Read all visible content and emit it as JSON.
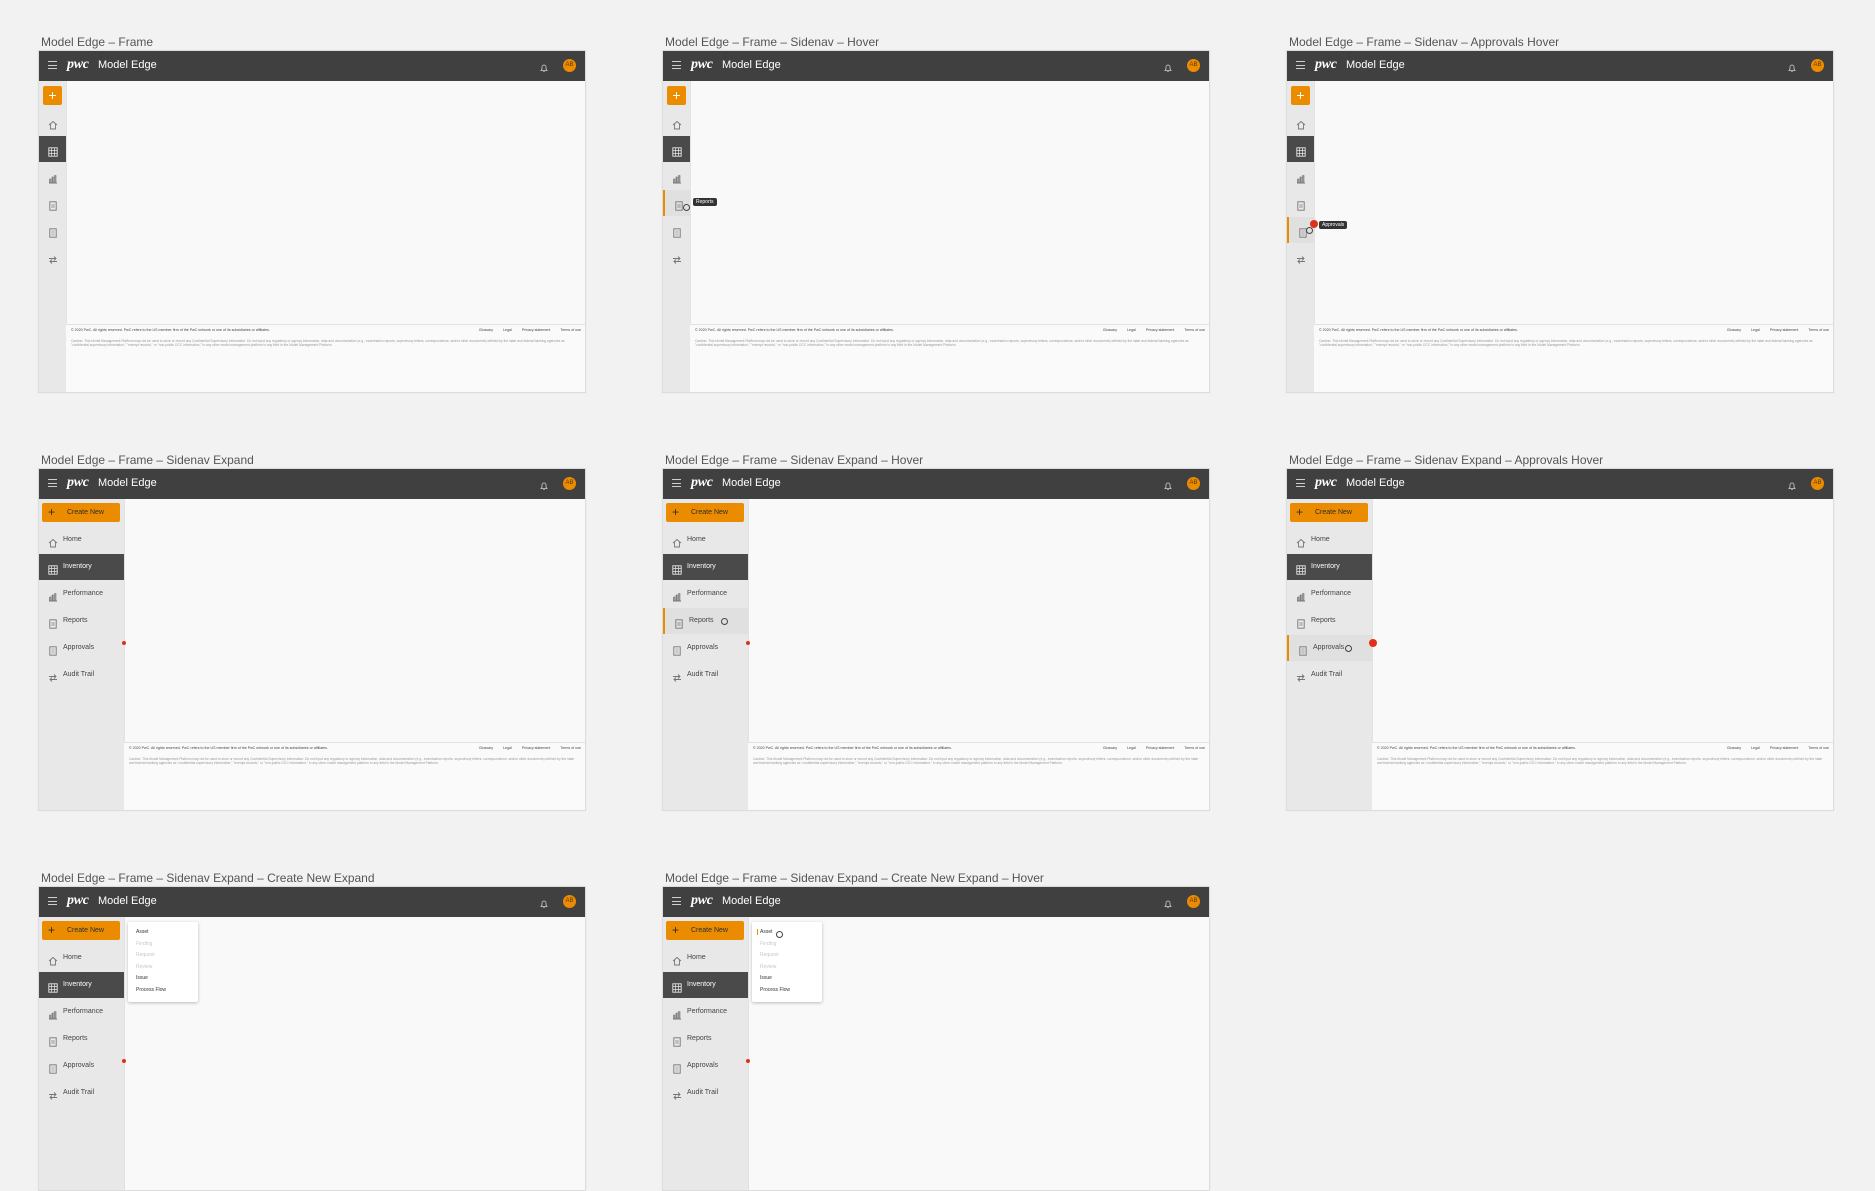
{
  "app": {
    "logo": "pwc",
    "name": "Model Edge",
    "avatar_initials": "AB"
  },
  "frames": [
    {
      "title": "Model Edge – Frame"
    },
    {
      "title": "Model Edge – Frame – Sidenav – Hover"
    },
    {
      "title": "Model Edge – Frame – Sidenav – Approvals Hover"
    },
    {
      "title": "Model Edge – Frame – Sidenav Expand"
    },
    {
      "title": "Model Edge – Frame – Sidenav Expand – Hover"
    },
    {
      "title": "Model Edge – Frame – Sidenav Expand – Approvals Hover"
    },
    {
      "title": "Model Edge – Frame – Sidenav Expand – Create New Expand"
    },
    {
      "title": "Model Edge – Frame – Sidenav Expand – Create New Expand – Hover"
    }
  ],
  "nav": {
    "create_new": "Create New",
    "items": [
      "Home",
      "Inventory",
      "Performance",
      "Reports",
      "Approvals",
      "Audit Trail"
    ]
  },
  "tooltips": {
    "reports": "Reports",
    "approvals": "Approvals"
  },
  "create_menu": [
    "Asset",
    "Finding",
    "Request",
    "Review",
    "Issue",
    "Process Flow"
  ],
  "footer": {
    "copyright": "© 2020 PwC. All rights reserved. PwC refers to the US member firm of the PwC network or one of its subsidiaries or affiliates.",
    "links": [
      "Glossary",
      "Legal",
      "Privacy statement",
      "Terms of use"
    ],
    "caution": "Caution: This Model Management Platform may not be used to store or record any Confidential Supervisory Information. Do not input any regulatory or agency information, data and documentation (e.g., examination reports, supervisory letters, correspondence, and/or other documents) defined by the state and federal banking agencies as \"confidential supervisory information,\" \"exempt records,\" or \"non-public OCC information,\" in any other model management platform in any field in the Model Management Platform."
  },
  "colors": {
    "accent": "#eb8c00",
    "topbar": "#404041",
    "alert": "#e0301e"
  }
}
